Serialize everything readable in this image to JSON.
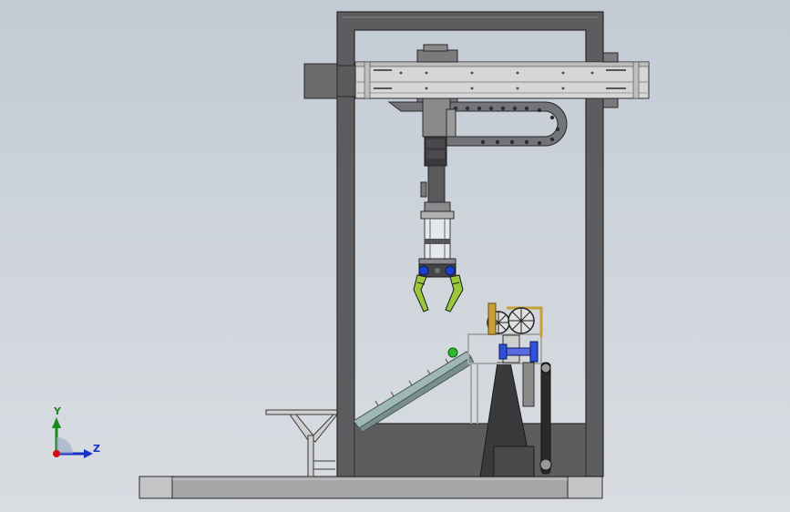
{
  "triad": {
    "y_label": "Y",
    "z_label": "Z",
    "y_color": "#1a8a1a",
    "z_color": "#1a2fc9",
    "origin_color": "#d01010"
  },
  "colors": {
    "background_top": "#c2cad4",
    "frame": "#5d5d5f",
    "frame_edge": "#2a2a2c",
    "base_plate": "#a6a6a8",
    "gearbox": "#6a6a6a",
    "rail": "#d6d6d6",
    "chain": "#727478",
    "gripper_blue": "#1e40d0",
    "gripper_green": "#9ac83a",
    "conveyor": "#9fb8b4",
    "wheel_gold": "#c8a038",
    "roller_blue": "#3050d8",
    "ball_green": "#2fb82f"
  }
}
